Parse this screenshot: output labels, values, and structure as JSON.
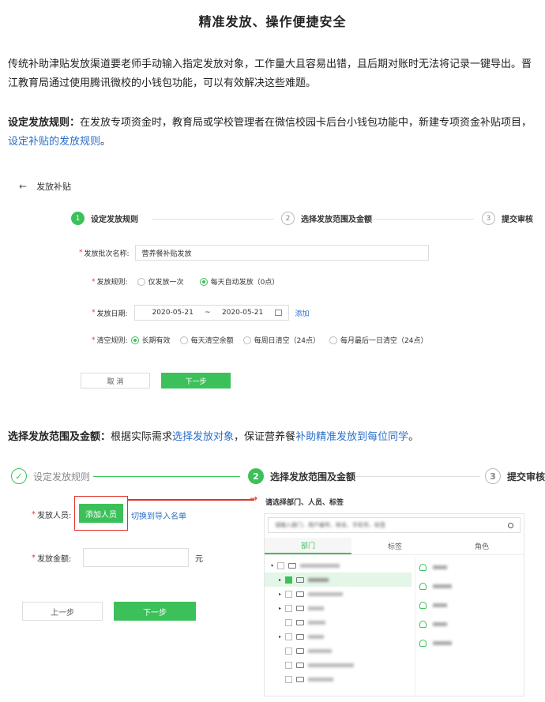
{
  "title": "精准发放、操作便捷安全",
  "intro": "传统补助津贴发放渠道要老师手动输入指定发放对象，工作量大且容易出错，且后期对账时无法将记录一键导出。晋江教育局通过使用腾讯微校的小钱包功能，可以有效解决这些难题。",
  "rule_section": {
    "heading": "设定发放规则：",
    "text": "在发放专项资金时，教育局或学校管理者在微信校园卡后台小钱包功能中，新建专项资金补贴项目，",
    "link": "设定补贴的发放规则",
    "tail": "。"
  },
  "shot1": {
    "back_arrow": "←",
    "page_title": "发放补贴",
    "steps": [
      {
        "num": "1",
        "label": "设定发放规则"
      },
      {
        "num": "2",
        "label": "选择发放范围及金额"
      },
      {
        "num": "3",
        "label": "提交审核"
      }
    ],
    "batch_label": "发放批次名称:",
    "batch_value": "营养餐补贴发放",
    "rule_label": "发放规则:",
    "rule_opt1": "仅发放一次",
    "rule_opt2": "每天自动发放（0点）",
    "date_label": "发放日期:",
    "date_start": "2020-05-21",
    "date_sep": "~",
    "date_end": "2020-05-21",
    "date_add": "添加",
    "clear_label": "清空规则:",
    "clear_opt1": "长期有效",
    "clear_opt2": "每天清空余额",
    "clear_opt3": "每周日清空（24点）",
    "clear_opt4": "每月最后一日清空（24点）",
    "cancel": "取 消",
    "next": "下一步"
  },
  "scope_section": {
    "heading": "选择发放范围及金额：",
    "text1": "根据实际需求",
    "link1": "选择发放对象",
    "text2": "，保证营养餐",
    "link2": "补助精准发放到每位同学",
    "tail": "。"
  },
  "shot2": {
    "step1": "设定发放规则",
    "step2_num": "2",
    "step2": "选择发放范围及金额",
    "step3_num": "3",
    "step3": "提交审核",
    "check_mark": "✓",
    "arrow": "→",
    "recipient_label": "发放人员:",
    "add_btn": "添加人员",
    "switch_link": "切换到导入名单",
    "amount_label": "发放金额:",
    "unit": "元",
    "prev": "上一步",
    "next": "下一步",
    "panel_title": "请选择部门、人员、标签",
    "search_placeholder": "请输入部门、用户编号、姓名、手机号、标签",
    "tabs": [
      "部门",
      "标签",
      "角色"
    ]
  },
  "colors": {
    "accent": "#3cc15a",
    "link": "#2a6fc9",
    "highlight": "#e0342c"
  }
}
